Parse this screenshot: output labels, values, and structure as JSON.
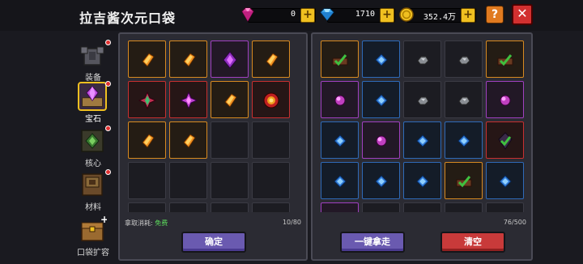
{
  "header": {
    "title": "拉吉酱次元口袋",
    "gems": "0",
    "diamonds": "1710",
    "coins": "352.4万",
    "help_label": "?",
    "close_label": "✕"
  },
  "sidebar": {
    "items": [
      {
        "label": "装备",
        "icon": "armor-icon"
      },
      {
        "label": "宝石",
        "icon": "gem-icon"
      },
      {
        "label": "核心",
        "icon": "core-icon"
      },
      {
        "label": "材料",
        "icon": "materials-icon"
      },
      {
        "label": "口袋扩容",
        "icon": "chest-expand-icon"
      }
    ],
    "active": "宝石"
  },
  "left_panel": {
    "cost_label": "拿取消耗:",
    "cost_value": "免费",
    "count": "10/80",
    "confirm_label": "确定"
  },
  "right_panel": {
    "count": "76/500",
    "take_all_label": "一键拿走",
    "clear_label": "清空"
  },
  "colors": {
    "accent": "#f0c020",
    "close": "#d23030",
    "help": "#e07a20",
    "confirm": "#6a5ab0",
    "clear": "#c83a3a",
    "free": "#5ee05e"
  }
}
